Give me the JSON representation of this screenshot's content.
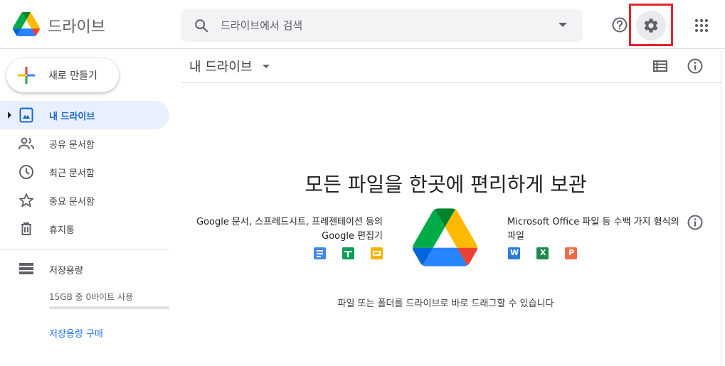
{
  "header": {
    "app_title": "드라이브",
    "search_placeholder": "드라이브에서 검색"
  },
  "sidebar": {
    "new_button_label": "새로 만들기",
    "items": [
      {
        "label": "내 드라이브",
        "icon": "my-drive-icon",
        "active": true
      },
      {
        "label": "공유 문서함",
        "icon": "people-icon",
        "active": false
      },
      {
        "label": "최근 문서함",
        "icon": "clock-icon",
        "active": false
      },
      {
        "label": "중요 문서함",
        "icon": "star-icon",
        "active": false
      },
      {
        "label": "휴지통",
        "icon": "trash-icon",
        "active": false
      }
    ],
    "storage": {
      "label": "저장용량",
      "usage_text": "15GB 중 0바이트 사용",
      "usage_fraction": 0,
      "buy_label": "저장용량 구매"
    }
  },
  "main": {
    "title": "내 드라이브",
    "empty_state": {
      "heading": "모든 파일을 한곳에 편리하게 보관",
      "left_caption": "Google 문서, 스프레드시트, 프레젠테이션 등의 Google 편집기",
      "right_caption": "Microsoft Office 파일 등 수백 가지 형식의 파일",
      "drop_hint": "파일 또는 폴더를 드라이브로 바로 드래그할 수 있습니다"
    }
  },
  "colors": {
    "accent": "#1a73e8",
    "active_bg": "#e8f0fe",
    "highlight_frame": "#e0262d"
  }
}
